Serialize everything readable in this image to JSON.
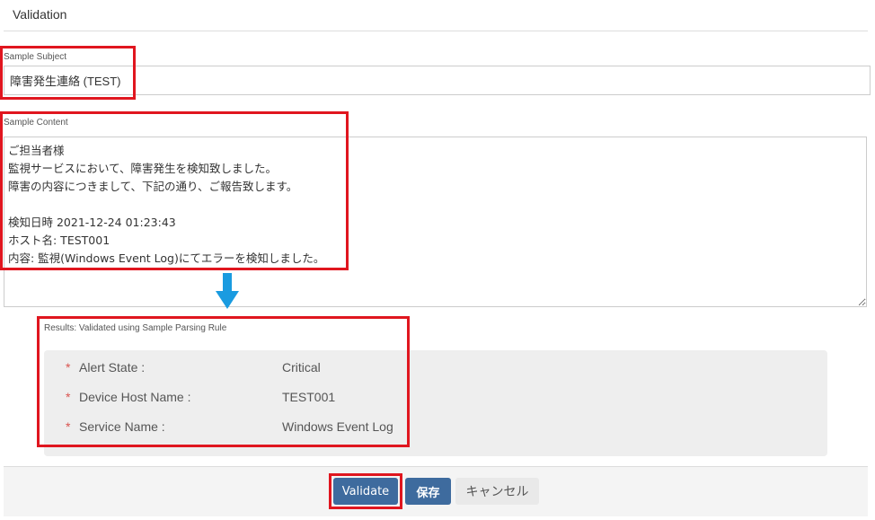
{
  "section": {
    "title": "Validation"
  },
  "subject": {
    "label": "Sample Subject",
    "value": "障害発生連絡 (TEST)"
  },
  "content": {
    "label": "Sample Content",
    "value": "ご担当者様\n監視サービスにおいて、障害発生を検知致しました。\n障害の内容につきまして、下記の通り、ご報告致します。\n\n検知日時 2021-12-24 01:23:43\nホスト名: TEST001\n内容: 監視(Windows Event Log)にてエラーを検知しました。"
  },
  "results": {
    "label": "Results: Validated using Sample Parsing Rule",
    "rows": [
      {
        "required_mark": "*",
        "key": "Alert State :",
        "value": "Critical"
      },
      {
        "required_mark": "*",
        "key": "Device Host Name :",
        "value": "TEST001"
      },
      {
        "required_mark": "*",
        "key": "Service Name :",
        "value": "Windows Event Log"
      }
    ]
  },
  "footer": {
    "validate_label": "Validate",
    "save_label": "保存",
    "cancel_label": "キャンセル"
  },
  "colors": {
    "highlight": "#e0161f",
    "primary_button": "#3e6b9e",
    "arrow": "#1a9be0",
    "required_star": "#d9534f"
  },
  "icons": {
    "flow_arrow": "arrow-down-icon"
  }
}
